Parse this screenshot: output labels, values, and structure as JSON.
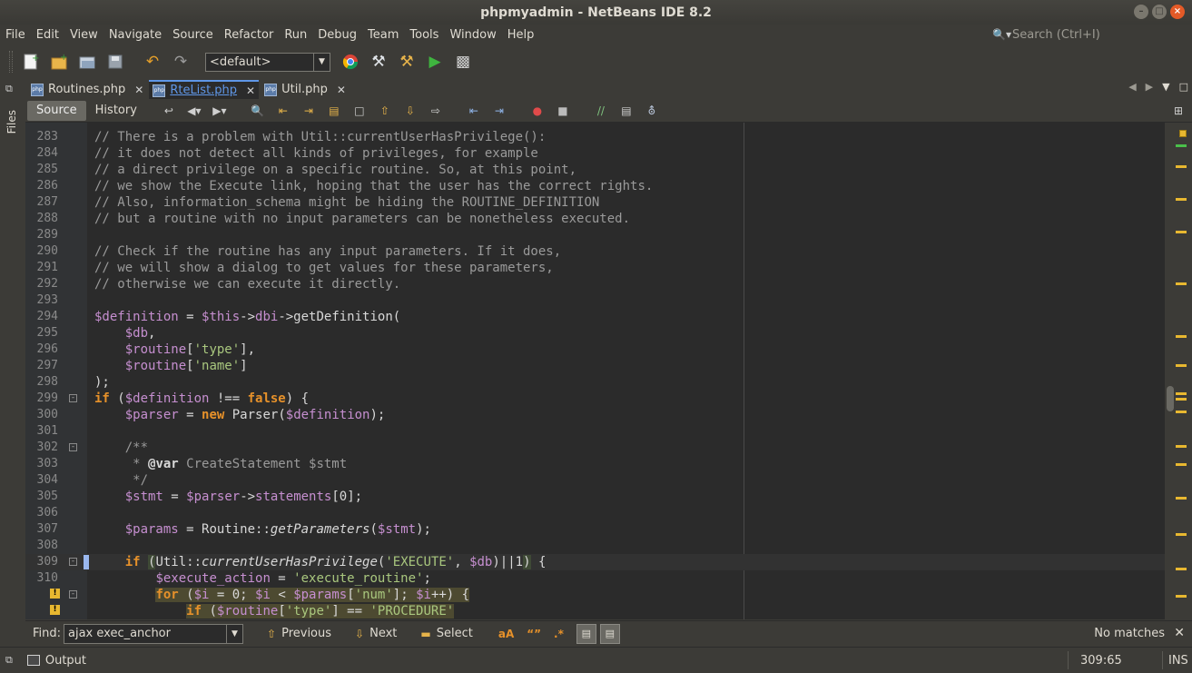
{
  "window": {
    "title": "phpmyadmin - NetBeans IDE 8.2"
  },
  "menu": [
    "File",
    "Edit",
    "View",
    "Navigate",
    "Source",
    "Refactor",
    "Run",
    "Debug",
    "Team",
    "Tools",
    "Window",
    "Help"
  ],
  "quick_search": {
    "placeholder": "Search (Ctrl+I)"
  },
  "toolbar": {
    "config": "<default>"
  },
  "side_panel": {
    "files_label": "Files"
  },
  "tabs": [
    {
      "label": "Routines.php",
      "active": false
    },
    {
      "label": "RteList.php",
      "active": true
    },
    {
      "label": "Util.php",
      "active": false
    }
  ],
  "editor_tabs": {
    "source": "Source",
    "history": "History"
  },
  "code_lines": [
    {
      "n": "283",
      "html": "<span class='c-cm'>// There is a problem with Util::currentUserHasPrivilege():</span>"
    },
    {
      "n": "284",
      "html": "<span class='c-cm'>// it does not detect all kinds of privileges, for example</span>"
    },
    {
      "n": "285",
      "html": "<span class='c-cm'>// a direct privilege on a specific routine. So, at this point,</span>"
    },
    {
      "n": "286",
      "html": "<span class='c-cm'>// we show the Execute link, hoping that the user has the correct rights.</span>"
    },
    {
      "n": "287",
      "html": "<span class='c-cm'>// Also, information_schema might be hiding the ROUTINE_DEFINITION</span>"
    },
    {
      "n": "288",
      "html": "<span class='c-cm'>// but a routine with no input parameters can be nonetheless executed.</span>"
    },
    {
      "n": "289",
      "html": ""
    },
    {
      "n": "290",
      "html": "<span class='c-cm'>// Check if the routine has any input parameters. If it does,</span>"
    },
    {
      "n": "291",
      "html": "<span class='c-cm'>// we will show a dialog to get values for these parameters,</span>"
    },
    {
      "n": "292",
      "html": "<span class='c-cm'>// otherwise we can execute it directly.</span>"
    },
    {
      "n": "293",
      "html": ""
    },
    {
      "n": "294",
      "html": "<span class='c-var'>$definition</span><span class='c-txt'> = </span><span class='c-var'>$this</span><span class='c-txt'>-></span><span class='c-var'>dbi</span><span class='c-txt'>->getDefinition(</span>"
    },
    {
      "n": "295",
      "html": "<span class='c-txt'>    </span><span class='c-var'>$db</span><span class='c-txt'>,</span>"
    },
    {
      "n": "296",
      "html": "<span class='c-txt'>    </span><span class='c-var'>$routine</span><span class='c-txt'>[</span><span class='c-str'>'type'</span><span class='c-txt'>],</span>"
    },
    {
      "n": "297",
      "html": "<span class='c-txt'>    </span><span class='c-var'>$routine</span><span class='c-txt'>[</span><span class='c-str'>'name'</span><span class='c-txt'>]</span>"
    },
    {
      "n": "298",
      "html": "<span class='c-txt'>);</span>"
    },
    {
      "n": "299",
      "html": "<span class='c-kw'>if</span><span class='c-txt'> (</span><span class='c-var'>$definition</span><span class='c-txt'> !== </span><span class='c-kw'>false</span><span class='c-txt'>) {</span>",
      "fold": true
    },
    {
      "n": "300",
      "html": "<span class='c-txt'>    </span><span class='c-var'>$parser</span><span class='c-txt'> = </span><span class='c-kw'>new</span><span class='c-txt'> Parser(</span><span class='c-var'>$definition</span><span class='c-txt'>);</span>"
    },
    {
      "n": "301",
      "html": ""
    },
    {
      "n": "302",
      "html": "<span class='c-cm'>    /**</span>",
      "fold": true
    },
    {
      "n": "303",
      "html": "<span class='c-cm'>     * </span><span class='c-tag'>@var</span><span class='c-cm'> CreateStatement $stmt</span>"
    },
    {
      "n": "304",
      "html": "<span class='c-cm'>     */</span>"
    },
    {
      "n": "305",
      "html": "<span class='c-txt'>    </span><span class='c-var'>$stmt</span><span class='c-txt'> = </span><span class='c-var'>$parser</span><span class='c-txt'>-></span><span class='c-var'>statements</span><span class='c-txt'>[0];</span>"
    },
    {
      "n": "306",
      "html": ""
    },
    {
      "n": "307",
      "html": "<span class='c-txt'>    </span><span class='c-var'>$params</span><span class='c-txt'> = Routine::</span><span class='c-it'>getParameters</span><span class='c-txt'>(</span><span class='c-var'>$stmt</span><span class='c-txt'>);</span>"
    },
    {
      "n": "308",
      "html": ""
    },
    {
      "n": "309",
      "html": "<span class='c-txt'>    </span><span class='c-kw'>if</span><span class='c-txt'> </span><span class='hl-match c-txt'>(</span><span class='c-txt'>Util::</span><span class='c-it'>currentUserHasPrivilege</span><span class='c-txt'>(</span><span class='c-str'>'EXECUTE'</span><span class='c-txt'>, </span><span class='c-var'>$db</span><span class='c-txt'>)||1</span><span class='hl-match c-txt'>)</span><span class='c-txt'> {</span>",
      "current": true,
      "fold": true
    },
    {
      "n": "310",
      "html": "<span class='c-txt'>        </span><span class='c-var'>$execute_action</span><span class='c-txt'> = </span><span class='c-str'>'execute_routine'</span><span class='c-txt'>;</span>"
    },
    {
      "n": "",
      "html": "<span class='c-txt'>        </span><span class='hl-for'><span class='c-kw'>for</span><span class='c-txt'> (</span><span class='c-var'>$i</span><span class='c-txt'> = 0; </span><span class='c-var'>$i</span><span class='c-txt'> &lt; </span><span class='c-var'>$params</span><span class='c-txt'>[</span><span class='c-str'>'num'</span><span class='c-txt'>]; </span><span class='c-var'>$i</span><span class='c-txt'>++) {</span></span>",
      "warn": true,
      "fold": true
    },
    {
      "n": "",
      "html": "<span class='c-txt'>            </span><span class='hl-for'><span class='c-kw'>if</span><span class='c-txt'> (</span><span class='c-var'>$routine</span><span class='c-txt'>[</span><span class='c-str'>'type'</span><span class='c-txt'>] == </span><span class='c-str'>'PROCEDURE'</span></span>",
      "warn": true
    }
  ],
  "find": {
    "label": "Find:",
    "value": "ajax exec_anchor",
    "previous": "Previous",
    "next": "Next",
    "select": "Select",
    "status": "No matches"
  },
  "status": {
    "output": "Output",
    "position": "309:65",
    "mode": "INS"
  }
}
